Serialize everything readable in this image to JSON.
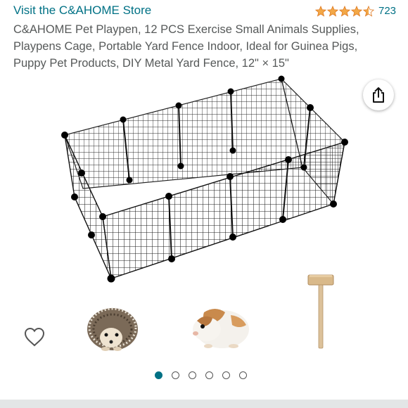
{
  "store": {
    "link_text": "Visit the C&AHOME Store"
  },
  "rating": {
    "stars": 4.5,
    "count": "723",
    "star_color": "#F3A847"
  },
  "product": {
    "title": "C&AHOME Pet Playpen, 12 PCS Exercise Small Animals Supplies, Playpens Cage, Portable Yard Fence Indoor, Ideal for Guinea Pigs, Puppy Pet Products, DIY Metal Yard Fence, 12\" × 15\""
  },
  "gallery": {
    "image_count": 6,
    "active_index": 0,
    "thumbnails": [
      "hedgehog",
      "guinea-pig",
      "wooden-mallet"
    ]
  },
  "icons": {
    "share": "share-icon",
    "wishlist": "heart-icon"
  },
  "colors": {
    "link": "#007185",
    "accent_dot": "#007185"
  }
}
